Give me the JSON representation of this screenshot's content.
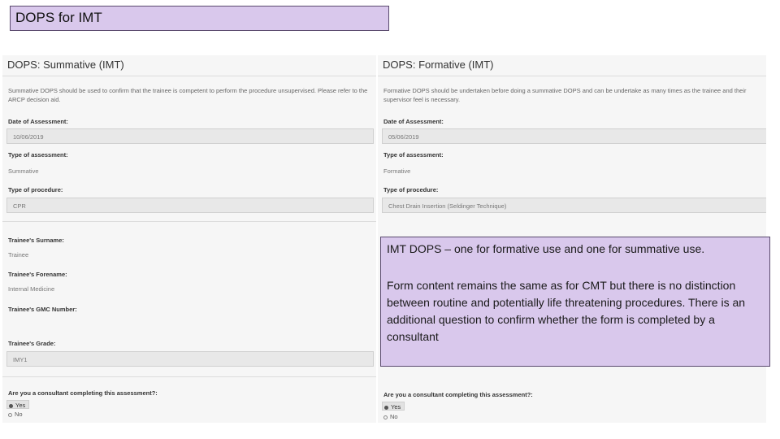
{
  "slide_title": "DOPS for IMT",
  "left": {
    "title": "DOPS: Summative (IMT)",
    "description": "Summative DOPS should be used to confirm that the trainee is competent to perform the procedure unsupervised. Please refer to the ARCP decision aid.",
    "date_label": "Date of Assessment:",
    "date_value": "10/06/2019",
    "type_label": "Type of assessment:",
    "type_value": "Summative",
    "procedure_label": "Type of procedure:",
    "procedure_value": "CPR",
    "surname_label": "Trainee's Surname:",
    "surname_value": "Trainee",
    "forename_label": "Trainee's Forename:",
    "forename_value": "Internal Medicine",
    "gmc_label": "Trainee's GMC Number:",
    "grade_label": "Trainee's Grade:",
    "grade_value": "IMY1",
    "consultant_label": "Are you a consultant completing this assessment?:",
    "yes_label": "Yes",
    "no_label": "No"
  },
  "right": {
    "title": "DOPS: Formative (IMT)",
    "description": "Formative DOPS should be undertaken before doing a summative DOPS and can be undertake as many times as the trainee and their supervisor feel is necessary.",
    "date_label": "Date of Assessment:",
    "date_value": "05/06/2019",
    "type_label": "Type of assessment:",
    "type_value": "Formative",
    "procedure_label": "Type of procedure:",
    "procedure_value": "Chest Drain Insertion (Seldinger Technique)",
    "consultant_label": "Are you a consultant completing this assessment?:",
    "yes_label": "Yes",
    "no_label": "No"
  },
  "callout": {
    "heading": "IMT DOPS – one for formative use and one for summative use.",
    "body": "Form content remains the same as for CMT but there is no distinction between routine and potentially life threatening procedures.  There is an additional question to confirm whether the form is completed by a consultant"
  },
  "colors": {
    "callout_fill": "#d9c8ec",
    "callout_border": "#5a4a6e"
  }
}
